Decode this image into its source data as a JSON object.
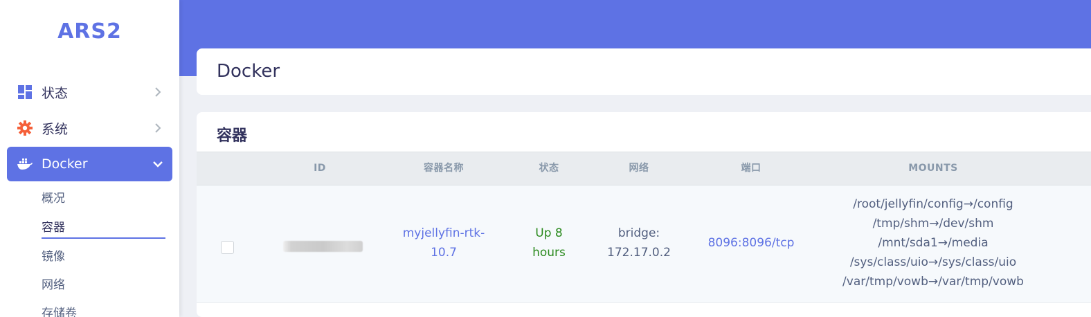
{
  "brand": "ARS2",
  "sidebar": {
    "items": [
      {
        "label": "状态",
        "icon": "dashboard-icon"
      },
      {
        "label": "系统",
        "icon": "gear-icon"
      },
      {
        "label": "Docker",
        "icon": "docker-icon"
      }
    ],
    "docker_sub": [
      {
        "label": "概况"
      },
      {
        "label": "容器"
      },
      {
        "label": "镜像"
      },
      {
        "label": "网络"
      },
      {
        "label": "存储卷"
      }
    ]
  },
  "page": {
    "title": "Docker",
    "section_title": "容器"
  },
  "table": {
    "headers": [
      "ID",
      "容器名称",
      "状态",
      "网络",
      "端口",
      "MOUNTS"
    ],
    "rows": [
      {
        "name_line1": "myjellyfin-rtk-",
        "name_line2": "10.7",
        "status_line1": "Up 8",
        "status_line2": "hours",
        "network_line1": "bridge:",
        "network_line2": "172.17.0.2",
        "port": "8096:8096/tcp",
        "mounts": [
          "/root/jellyfin/config→/config",
          "/tmp/shm→/dev/shm",
          "/mnt/sda1→/media",
          "/sys/class/uio→/sys/class/uio",
          "/var/tmp/vowb→/var/tmp/vowb"
        ]
      }
    ]
  },
  "colors": {
    "accent": "#5e72e4",
    "status_up": "#2b8a1e",
    "gear": "#f5603a"
  }
}
